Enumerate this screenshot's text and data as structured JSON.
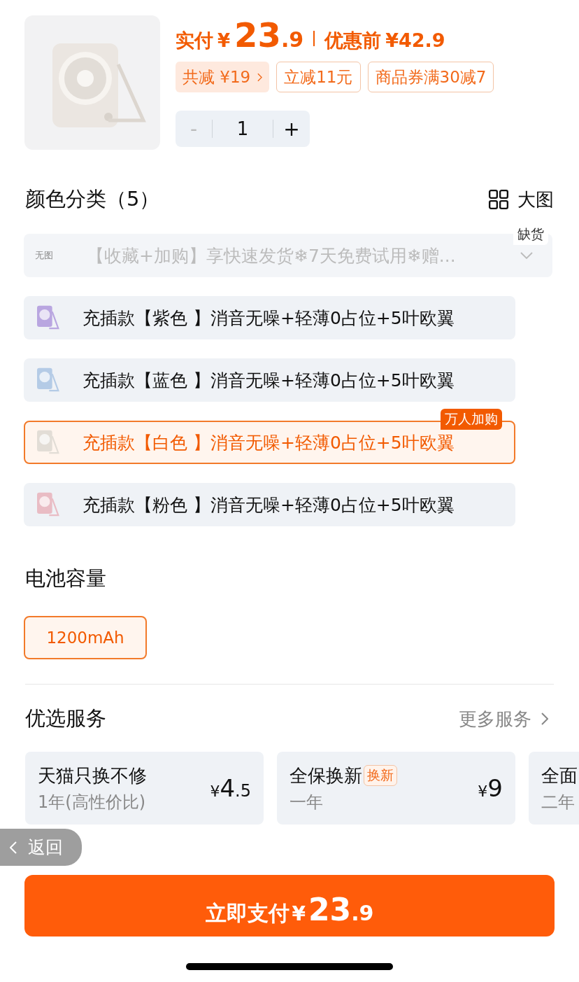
{
  "price": {
    "label": "实付",
    "currency": "¥",
    "integer": "23",
    "decimal": ".9",
    "original_label": "优惠前",
    "original_price": "¥42.9"
  },
  "tags": [
    {
      "text": "共减 ¥19",
      "kind": "total"
    },
    {
      "text": "立减11元",
      "kind": "plain"
    },
    {
      "text": "商品券满30减7",
      "kind": "plain"
    }
  ],
  "quantity": {
    "minus": "-",
    "value": "1",
    "plus": "+",
    "minus_disabled": true
  },
  "color_section": {
    "title": "颜色分类（5）",
    "view_label": "大图",
    "options": [
      {
        "kind": "noimage",
        "thumb": "无图",
        "text": "【收藏+加购】享快速发货❄7天免费试用❄赠...",
        "selected": false,
        "disabled": true,
        "badge": "缺货"
      },
      {
        "color": "#b9a6e0",
        "text": "充插款【紫色 】消音无噪+轻薄0占位+5叶欧翼",
        "selected": false,
        "disabled": false
      },
      {
        "color": "#b4cbe6",
        "text": "充插款【蓝色 】消音无噪+轻薄0占位+5叶欧翼",
        "selected": false,
        "disabled": false
      },
      {
        "color": "#e2ddd6",
        "text": "充插款【白色 】消音无噪+轻薄0占位+5叶欧翼",
        "selected": true,
        "disabled": false,
        "badge": "万人加购"
      },
      {
        "color": "#e9bcc4",
        "text": "充插款【粉色 】消音无噪+轻薄0占位+5叶欧翼",
        "selected": false,
        "disabled": false
      }
    ]
  },
  "battery_section": {
    "title": "电池容量",
    "options": [
      {
        "text": "1200mAh",
        "selected": true
      }
    ]
  },
  "services": {
    "title": "优选服务",
    "more": "更多服务",
    "cards": [
      {
        "name": "天猫只换不修",
        "term": "1年(高性价比)",
        "currency": "¥",
        "price_int": "4",
        "price_dec": ".5"
      },
      {
        "name": "全保换新",
        "tag": "换新",
        "term": "一年",
        "currency": "¥",
        "price_int": "9"
      },
      {
        "name": "全面",
        "term": "二年"
      }
    ]
  },
  "back_button": {
    "label": "返回"
  },
  "pay_button": {
    "label": "立即支付",
    "currency": "¥",
    "integer": "23",
    "decimal": ".9"
  }
}
